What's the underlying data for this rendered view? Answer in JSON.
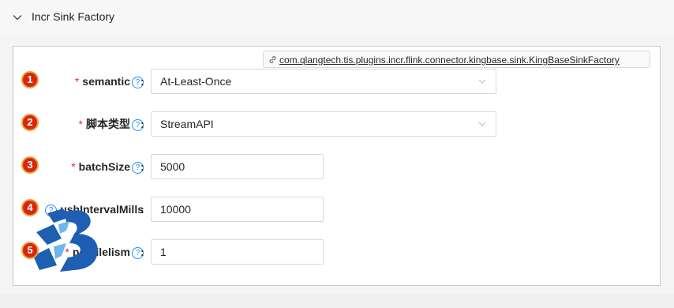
{
  "section": {
    "title": "Incr Sink Factory"
  },
  "plugin_class": "com.qlangtech.tis.plugins.incr.flink.connector.kingbase.sink.KingBaseSinkFactory",
  "fields": [
    {
      "index": "1",
      "label": "semantic",
      "required": "*",
      "type": "select",
      "value": "At-Least-Once"
    },
    {
      "index": "2",
      "label": "脚本类型",
      "required": "*",
      "type": "select",
      "value": "StreamAPI"
    },
    {
      "index": "3",
      "label": "batchSize",
      "required": "*",
      "type": "input",
      "value": "5000"
    },
    {
      "index": "4",
      "label": "ushIntervalMills",
      "required": "",
      "type": "input",
      "value": "10000"
    },
    {
      "index": "5",
      "label": "parallelism",
      "required": "*",
      "type": "input",
      "value": "1"
    }
  ],
  "help_glyph": "?",
  "colon": ":",
  "colors": {
    "badge": "#d8260d",
    "badge_ring": "#f0a13a",
    "required": "#f5222d",
    "help": "#1890ff",
    "logo": "#1e5fb4"
  },
  "icons": {
    "collapse": "chevron-down-icon",
    "link": "link-icon",
    "help": "question-circle-icon",
    "select": "chevron-down-icon"
  }
}
